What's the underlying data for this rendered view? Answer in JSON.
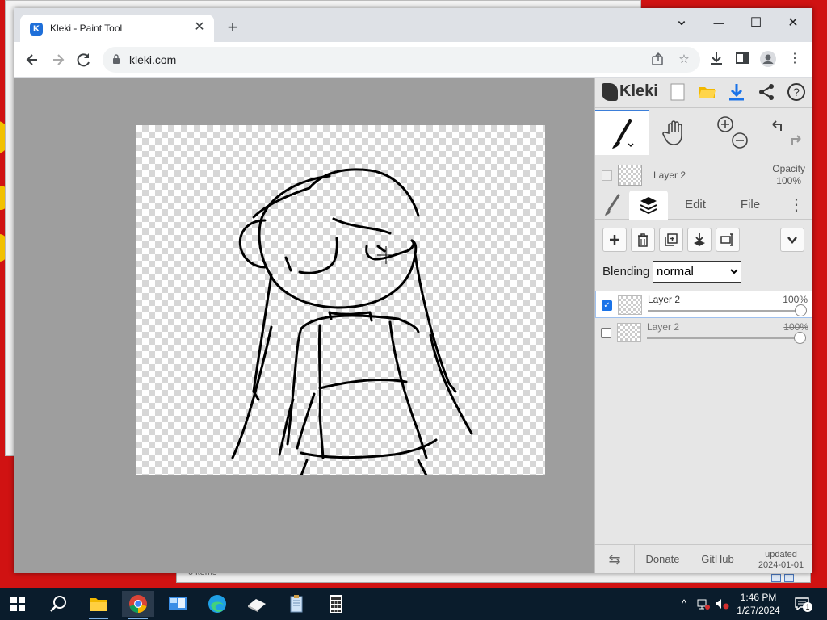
{
  "browser": {
    "tab_title": "Kleki - Paint Tool",
    "tab_close": "✕",
    "new_tab": "+",
    "url": "kleki.com",
    "controls": {
      "minimize": "—",
      "maximize": "☐",
      "close": "✕",
      "tab_search": "⌄"
    },
    "icons": [
      "back-icon",
      "forward-icon",
      "reload-icon",
      "lock-icon",
      "share-icon",
      "bookmark-star-icon",
      "download-icon",
      "side-panel-icon",
      "profile-icon",
      "menu-dots-icon"
    ]
  },
  "kleki": {
    "logo_text": "Kleki",
    "header_icons": [
      "new-image-icon",
      "open-folder-icon",
      "save-download-icon",
      "share-icon",
      "help-icon"
    ],
    "tools": [
      "brush-tool",
      "hand-tool",
      "zoom-tool",
      "undo-redo"
    ],
    "current_layer": {
      "name": "Layer 2",
      "opacity_label": "Opacity",
      "opacity_value": "100%"
    },
    "tabs": {
      "edit": "Edit",
      "file": "File"
    },
    "layer_actions": [
      "add-layer",
      "delete-layer",
      "duplicate-layer",
      "merge-down",
      "rename-layer",
      "collapse"
    ],
    "blending_label": "Blending",
    "blending_mode": "normal",
    "blending_options": [
      "normal"
    ],
    "layers": [
      {
        "name": "Layer 2",
        "opacity": "100%",
        "checked": true,
        "active": true,
        "opacity_fraction": 1.0
      },
      {
        "name": "Layer 2",
        "opacity": "100%",
        "checked": false,
        "active": false,
        "opacity_fraction": 1.0
      }
    ],
    "footer": {
      "donate": "Donate",
      "github": "GitHub",
      "updated_label": "updated",
      "updated_date": "2024-01-01"
    }
  },
  "background_window": {
    "status_text": "0 items"
  },
  "taskbar": {
    "apps": [
      "start-icon",
      "search-icon",
      "file-explorer-icon",
      "chrome-icon",
      "control-panel-icon",
      "edge-icon",
      "eraser-app-icon",
      "notepad-icon",
      "calculator-icon"
    ],
    "time": "1:46 PM",
    "date": "1/27/2024",
    "notification_count": "1"
  },
  "colors": {
    "desktop": "#d01212",
    "workspace": "#9e9e9e",
    "panel": "#e6e6e6",
    "accent": "#1a73e8",
    "taskbar": "#0a1c2c"
  }
}
